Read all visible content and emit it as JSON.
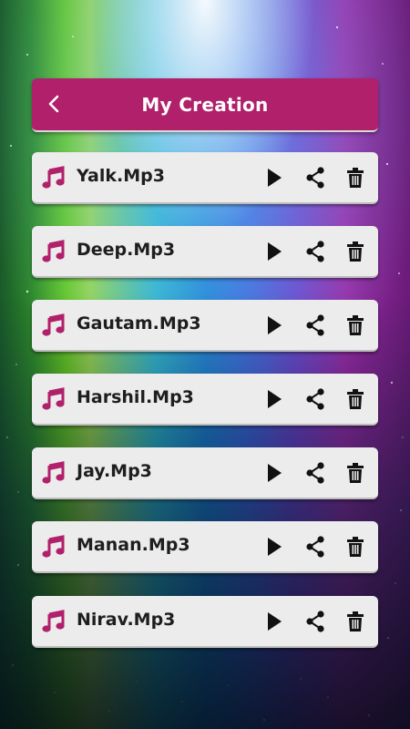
{
  "header": {
    "title": "My Creation",
    "back_icon": "chevron-left-icon",
    "background": "#b0206b"
  },
  "items": [
    {
      "name": "Yalk.Mp3"
    },
    {
      "name": "Deep.Mp3"
    },
    {
      "name": "Gautam.Mp3"
    },
    {
      "name": "Harshil.Mp3"
    },
    {
      "name": "Jay.Mp3"
    },
    {
      "name": "Manan.Mp3"
    },
    {
      "name": "Nirav.Mp3"
    }
  ],
  "icons": {
    "file": "music-note-icon",
    "play": "play-icon",
    "share": "share-icon",
    "delete": "trash-icon"
  },
  "colors": {
    "accent": "#b0206b",
    "card": "#ececec",
    "icon_dark": "#111111"
  }
}
